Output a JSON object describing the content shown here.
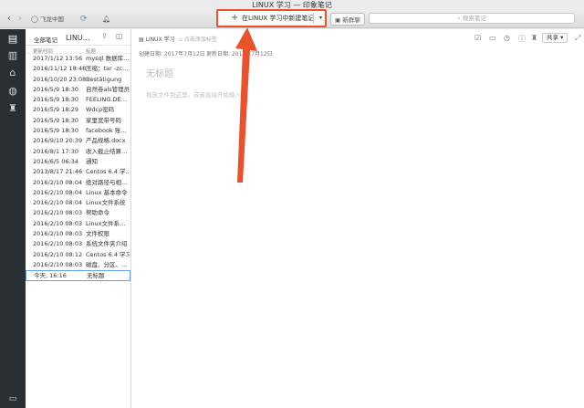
{
  "window": {
    "title": "LINUX 学习 — 印象笔记"
  },
  "toolbar": {
    "account": "飞龙中国",
    "new_note_label": "在LINUX 学习中新建笔记",
    "new_chat_label": "新群聊",
    "search_placeholder": "搜索笔记"
  },
  "list": {
    "scope": "全部笔记",
    "notebook": "LINU…",
    "col_date": "更新时间",
    "col_title": "标题",
    "rows": [
      {
        "date": "2017/1/12 13:56",
        "title": "mysql 数据库…"
      },
      {
        "date": "2016/11/12 18:48",
        "title": "压缩：tar -zc…"
      },
      {
        "date": "2016/10/20 23:08",
        "title": "Bestätigung"
      },
      {
        "date": "2016/5/9 18:30",
        "title": "自然卷als管理员"
      },
      {
        "date": "2016/5/9 18:30",
        "title": "FEELING.DE…"
      },
      {
        "date": "2016/5/9 18:29",
        "title": "Wdcp密码"
      },
      {
        "date": "2016/5/9 18:30",
        "title": "家里宽带号码"
      },
      {
        "date": "2016/5/9 18:30",
        "title": "facebook 账…"
      },
      {
        "date": "2016/9/10 20:39",
        "title": "产品规格.docx"
      },
      {
        "date": "2016/8/1 17:30",
        "title": "收入截止结算…"
      },
      {
        "date": "2016/6/5 06:34",
        "title": "通知"
      },
      {
        "date": "2013/8/17 21:46",
        "title": "Centos 6.4 学…"
      },
      {
        "date": "2016/2/10 08:04",
        "title": "绝对路径与相…"
      },
      {
        "date": "2016/2/10 08:04",
        "title": "Linux 基本命令"
      },
      {
        "date": "2016/2/10 08:04",
        "title": "Linux文件系统"
      },
      {
        "date": "2016/2/10 08:03",
        "title": "帮助命令"
      },
      {
        "date": "2016/2/10 08:03",
        "title": "Linux文件系…"
      },
      {
        "date": "2016/2/10 08:03",
        "title": "文件权限"
      },
      {
        "date": "2016/2/10 08:03",
        "title": "系统文件夹介绍"
      },
      {
        "date": "2016/2/10 08:12",
        "title": "Centos 6.4 学习"
      },
      {
        "date": "2016/2/10 08:03",
        "title": "磁盘、分区、…"
      },
      {
        "date": "今天, 16:16",
        "title": "无标题",
        "selected": true
      }
    ]
  },
  "note": {
    "notebook": "LINUX 学习",
    "tag_placeholder": "点击添加标签",
    "created": "创建日期: 2017年7月12日",
    "updated": "更新日期: 2017年7月12日",
    "title_placeholder": "无标题",
    "body_placeholder": "拖放文件到这里，或者直接开始输入",
    "share_label": "共享"
  },
  "colors": {
    "sidebar": "#2a2f33",
    "highlight": "#e9522d",
    "selection": "#6aa0e6"
  }
}
